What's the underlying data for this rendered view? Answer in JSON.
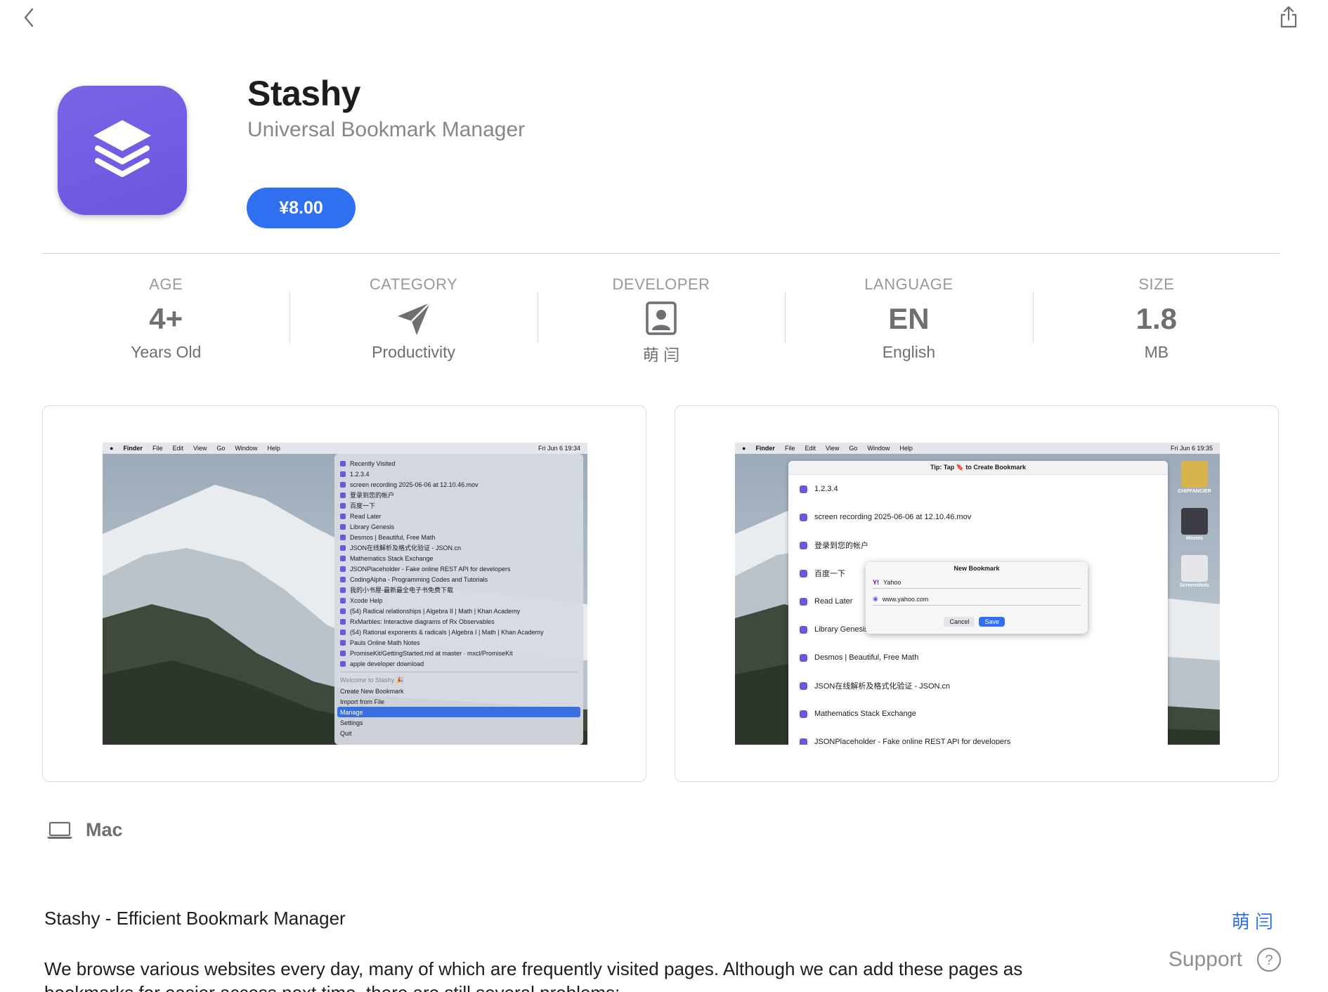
{
  "app": {
    "name": "Stashy",
    "subtitle": "Universal Bookmark Manager",
    "price": "¥8.00"
  },
  "info": [
    {
      "label": "AGE",
      "value": "4+",
      "sub": "Years Old"
    },
    {
      "label": "CATEGORY",
      "value": "",
      "icon": "paper-plane-icon",
      "sub": "Productivity"
    },
    {
      "label": "DEVELOPER",
      "value": "",
      "icon": "person-card-icon",
      "sub": "萌 闫"
    },
    {
      "label": "LANGUAGE",
      "value": "EN",
      "sub": "English"
    },
    {
      "label": "SIZE",
      "value": "1.8",
      "sub": "MB"
    }
  ],
  "screenshot1": {
    "menubar": {
      "left": [
        "Finder",
        "File",
        "Edit",
        "View",
        "Go",
        "Window",
        "Help"
      ],
      "clock": "Fri Jun 6  19:34"
    },
    "menu_items": [
      "Recently Visited",
      "1.2.3.4",
      "screen recording 2025-06-06 at 12.10.46.mov",
      "登录到您的帐户",
      "百度一下",
      "Read Later",
      "Library Genesis",
      "Desmos | Beautiful, Free Math",
      "JSON在线解析及格式化验证 - JSON.cn",
      "Mathematics Stack Exchange",
      "JSONPlaceholder - Fake online REST API for developers",
      "CodingAlpha - Programming Codes and Tutorials",
      "我的小书屋-最新最全电子书免费下载",
      "Xcode Help",
      "(54) Radical relationships | Algebra II | Math | Khan Academy",
      "RxMarbles: Interactive diagrams of Rx Observables",
      "(54) Rational exponents & radicals | Algebra I | Math | Khan Academy",
      "Pauls Online Math Notes",
      "PromiseKit/GettingStarted.md at master · mxcl/PromiseKit",
      "apple developer download"
    ],
    "footer_items": [
      "Welcome to Stashy 🎉",
      "Create New Bookmark",
      "Import from File",
      "Manage",
      "Settings",
      "Quit"
    ]
  },
  "screenshot2": {
    "menubar": {
      "left": [
        "Finder",
        "File",
        "Edit",
        "View",
        "Go",
        "Window",
        "Help"
      ],
      "clock": "Fri Jun 6  19:35"
    },
    "window_title": "Tip: Tap 🔖 to Create Bookmark",
    "items": [
      "1.2.3.4",
      "screen recording 2025-06-06 at 12.10.46.mov",
      "登录到您的帐户",
      "百度一下",
      "Read Later",
      "Library Genesis",
      "Desmos | Beautiful, Free Math",
      "JSON在线解析及格式化验证 - JSON.cn",
      "Mathematics Stack Exchange",
      "JSONPlaceholder - Fake online REST API for developers"
    ],
    "dialog": {
      "title": "New Bookmark",
      "name": "Yahoo",
      "url": "www.yahoo.com",
      "cancel": "Cancel",
      "save": "Save"
    },
    "dock": [
      "CHIPFANCIER",
      "Movies",
      "Screenshots"
    ]
  },
  "platform": "Mac",
  "description": {
    "title": "Stashy - Efficient Bookmark Manager",
    "body": "We browse various websites every day, many of which are frequently visited pages. Although we can add these pages as bookmarks for easier access next time, there are still several problems:"
  },
  "developer_link": "萌 闫",
  "support_label": "Support",
  "colors": {
    "accent": "#2f6ff0",
    "icon_bg": "#6c56de",
    "secondary_text": "#86868b"
  }
}
